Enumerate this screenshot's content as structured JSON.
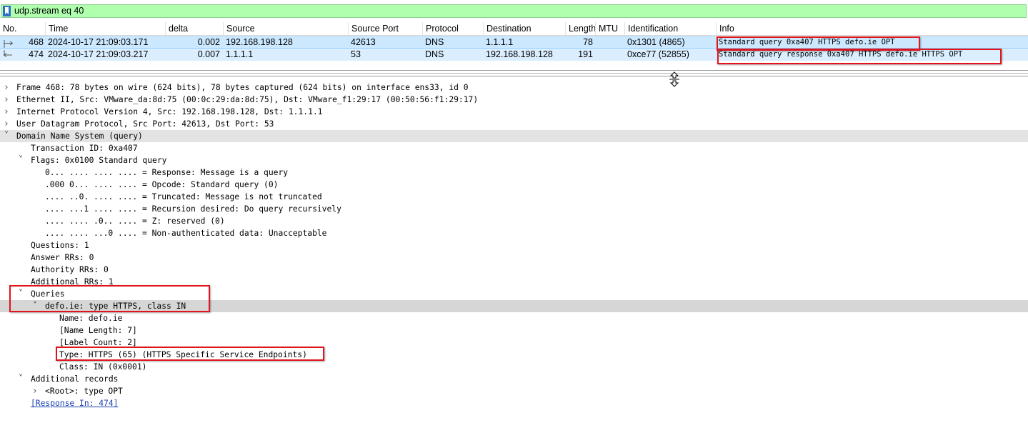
{
  "filter": {
    "value": "udp.stream eq 40"
  },
  "columns": [
    "No.",
    "Time",
    "delta",
    "Source",
    "Source Port",
    "Protocol",
    "Destination",
    "Length",
    "MTU",
    "Identification",
    "Info"
  ],
  "packets": [
    {
      "no": "468",
      "time": "2024-10-17 21:09:03.171",
      "delta": "0.002",
      "source": "192.168.198.128",
      "sport": "42613",
      "protocol": "DNS",
      "destination": "1.1.1.1",
      "length": "78",
      "mtu": "",
      "ident": "0x1301 (4865)",
      "info": "Standard query 0xa407 HTTPS defo.ie OPT"
    },
    {
      "no": "474",
      "time": "2024-10-17 21:09:03.217",
      "delta": "0.007",
      "source": "1.1.1.1",
      "sport": "53",
      "protocol": "DNS",
      "destination": "192.168.198.128",
      "length": "191",
      "mtu": "",
      "ident": "0xce77 (52855)",
      "info": "Standard query response 0xa407 HTTPS defo.ie HTTPS OPT"
    }
  ],
  "tree": [
    {
      "text": "Frame 468: 78 bytes on wire (624 bits), 78 bytes captured (624 bits) on interface ens33, id 0",
      "expander": "collapsed"
    },
    {
      "text": "Ethernet II, Src: VMware_da:8d:75 (00:0c:29:da:8d:75), Dst: VMware_f1:29:17 (00:50:56:f1:29:17)",
      "expander": "collapsed"
    },
    {
      "text": "Internet Protocol Version 4, Src: 192.168.198.128, Dst: 1.1.1.1",
      "expander": "collapsed"
    },
    {
      "text": "User Datagram Protocol, Src Port: 42613, Dst Port: 53",
      "expander": "collapsed"
    },
    {
      "text": "Domain Name System (query)",
      "expander": "expanded"
    },
    {
      "text": "Transaction ID: 0xa407",
      "expander": "none"
    },
    {
      "text": "Flags: 0x0100 Standard query",
      "expander": "expanded"
    },
    {
      "text": "0... .... .... .... = Response: Message is a query",
      "expander": "none"
    },
    {
      "text": ".000 0... .... .... = Opcode: Standard query (0)",
      "expander": "none"
    },
    {
      "text": ".... ..0. .... .... = Truncated: Message is not truncated",
      "expander": "none"
    },
    {
      "text": ".... ...1 .... .... = Recursion desired: Do query recursively",
      "expander": "none"
    },
    {
      "text": ".... .... .0.. .... = Z: reserved (0)",
      "expander": "none"
    },
    {
      "text": ".... .... ...0 .... = Non-authenticated data: Unacceptable",
      "expander": "none"
    },
    {
      "text": "Questions: 1",
      "expander": "none"
    },
    {
      "text": "Answer RRs: 0",
      "expander": "none"
    },
    {
      "text": "Authority RRs: 0",
      "expander": "none"
    },
    {
      "text": "Additional RRs: 1",
      "expander": "none"
    },
    {
      "text": "Queries",
      "expander": "expanded"
    },
    {
      "text": "defo.ie: type HTTPS, class IN",
      "expander": "expanded"
    },
    {
      "text": "Name: defo.ie",
      "expander": "none"
    },
    {
      "text": "[Name Length: 7]",
      "expander": "none"
    },
    {
      "text": "[Label Count: 2]",
      "expander": "none"
    },
    {
      "text": "Type: HTTPS (65) (HTTPS Specific Service Endpoints)",
      "expander": "none"
    },
    {
      "text": "Class: IN (0x0001)",
      "expander": "none"
    },
    {
      "text": "Additional records",
      "expander": "expanded"
    },
    {
      "text": "<Root>: type OPT",
      "expander": "collapsed"
    },
    {
      "text": "[Response In: 474]",
      "expander": "none"
    }
  ],
  "colors": {
    "filter_bg": "#afffaf",
    "selected_row": "#cce8ff",
    "annotation": "#e0141a"
  }
}
